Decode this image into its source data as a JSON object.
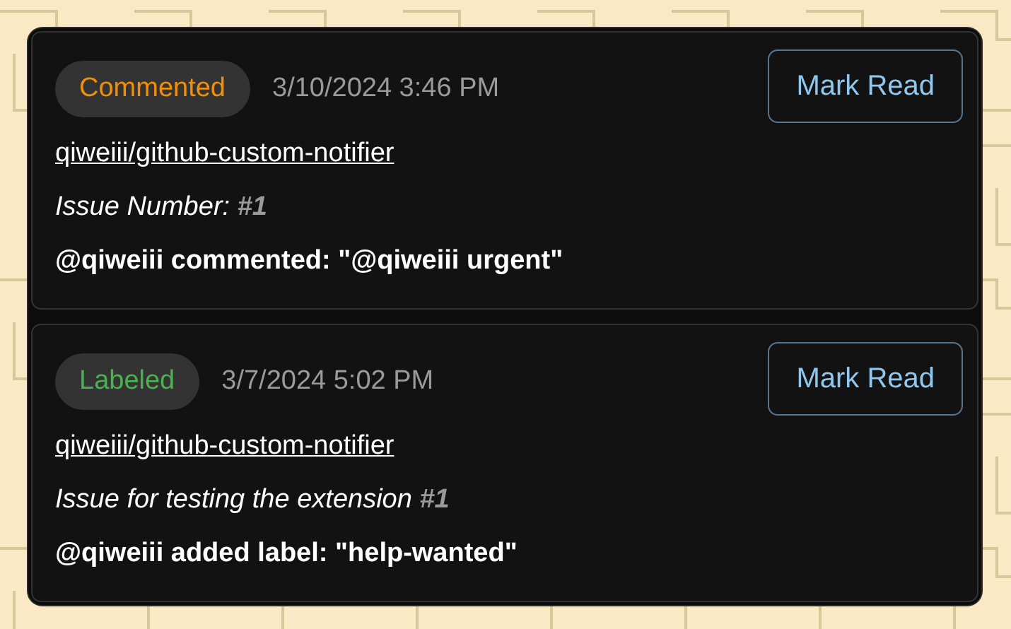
{
  "notifications": [
    {
      "event": "Commented",
      "color": "#f0900a",
      "time": "3/10/2024 3:46 PM",
      "button": "Mark Read",
      "repo": "qiweiii/github-custom-notifier",
      "issue": "Issue Number: **#1**",
      "message": "@qiweiii commented: \"@qiweiii urgent\""
    },
    {
      "event": "Labeled",
      "color": "#4caf50",
      "time": "3/7/2024 5:02 PM",
      "button": "Mark Read",
      "repo": "qiweiii/github-custom-notifier",
      "issue": "Issue for testing the extension **#1**",
      "message": "@qiweiii added label: \"help-wanted\""
    }
  ]
}
